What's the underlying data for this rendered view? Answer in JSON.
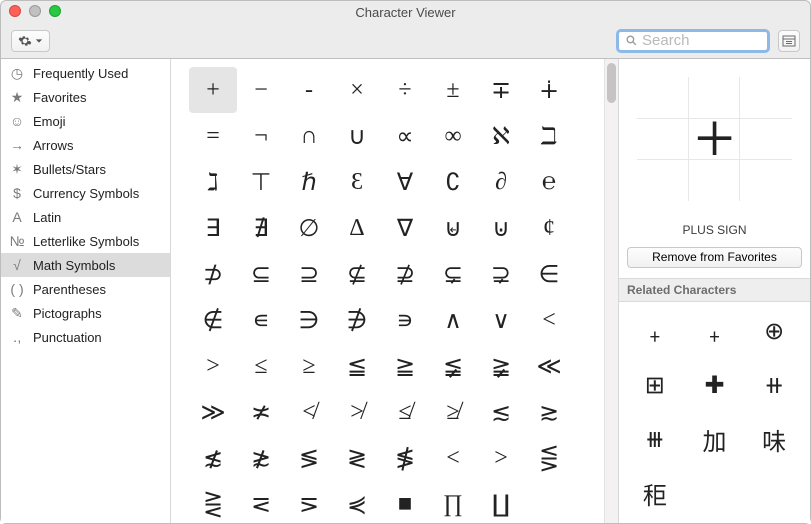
{
  "window": {
    "title": "Character Viewer"
  },
  "search": {
    "placeholder": "Search",
    "value": ""
  },
  "sidebar": {
    "items": [
      {
        "icon": "clock-icon",
        "glyph": "◷",
        "label": "Frequently Used"
      },
      {
        "icon": "star-icon",
        "glyph": "★",
        "label": "Favorites"
      },
      {
        "icon": "emoji-icon",
        "glyph": "☺",
        "label": "Emoji"
      },
      {
        "icon": "arrows-icon",
        "glyph": "→",
        "label": "Arrows"
      },
      {
        "icon": "bullets-icon",
        "glyph": "✶",
        "label": "Bullets/Stars"
      },
      {
        "icon": "currency-icon",
        "glyph": "$",
        "label": "Currency Symbols"
      },
      {
        "icon": "latin-icon",
        "glyph": "A",
        "label": "Latin"
      },
      {
        "icon": "letterlike-icon",
        "glyph": "№",
        "label": "Letterlike Symbols"
      },
      {
        "icon": "math-icon",
        "glyph": "√",
        "label": "Math Symbols"
      },
      {
        "icon": "parentheses-icon",
        "glyph": "( )",
        "label": "Parentheses"
      },
      {
        "icon": "pictographs-icon",
        "glyph": "✎",
        "label": "Pictographs"
      },
      {
        "icon": "punctuation-icon",
        "glyph": "․,",
        "label": "Punctuation"
      }
    ],
    "selected_index": 8
  },
  "grid": {
    "selected_index": 0,
    "chars": [
      "+",
      "−",
      "-",
      "×",
      "÷",
      "±",
      "∓",
      "∔",
      "=",
      "¬",
      "∩",
      "∪",
      "∝",
      "∞",
      "ℵ",
      "ℶ",
      "ℷ",
      "⊤",
      "ℏ",
      "Ɛ",
      "∀",
      "∁",
      "∂",
      "℮",
      "∃",
      "∄",
      "∅",
      "∆",
      "∇",
      "⊌",
      "⊍",
      "¢",
      "⊅",
      "⊆",
      "⊇",
      "⊈",
      "⊉",
      "⊊",
      "⊋",
      "∈",
      "∉",
      "∊",
      "∋",
      "∌",
      "∍",
      "∧",
      "∨",
      "<",
      ">",
      "≤",
      "≥",
      "≦",
      "≧",
      "≨",
      "≩",
      "≪",
      "≫",
      "≭",
      "≮",
      "≯",
      "≰",
      "≱",
      "≲",
      "≳",
      "≴",
      "≵",
      "≶",
      "≷",
      "≸",
      "<",
      ">",
      "⋚",
      "⋛",
      "⋜",
      "⋝",
      "⋞",
      "■",
      "∏",
      "∐",
      ""
    ]
  },
  "detail": {
    "big_char": "+",
    "name": "PLUS SIGN",
    "remove_label": "Remove from Favorites",
    "related_header": "Related Characters",
    "related": [
      "﹢",
      "﹢",
      "⊕",
      "⊞",
      "✚",
      "⧺",
      "⧻",
      "加",
      "味",
      "秬",
      ""
    ]
  }
}
